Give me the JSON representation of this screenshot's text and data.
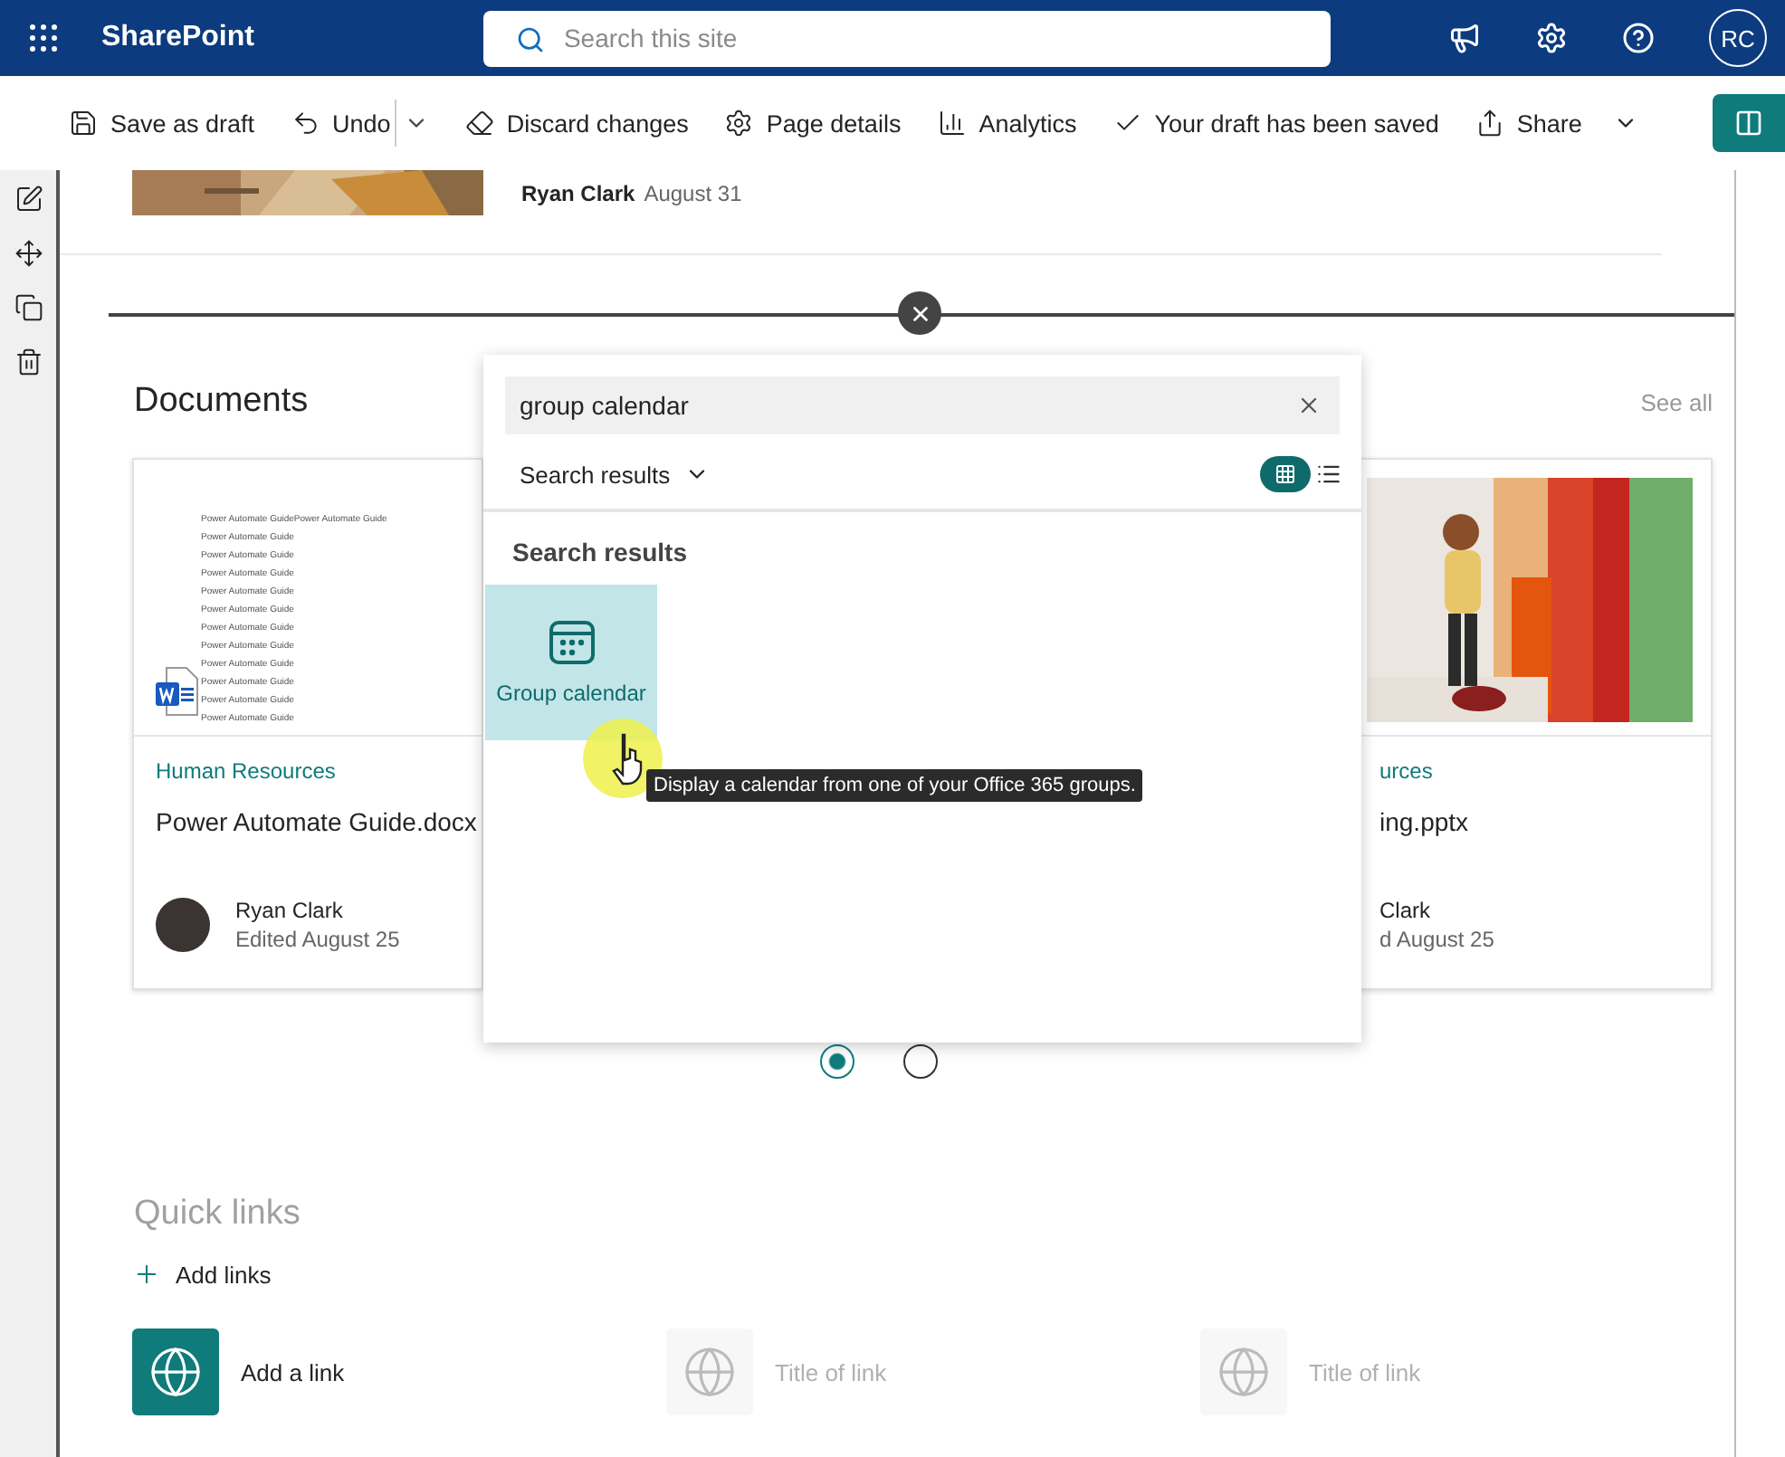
{
  "top_bar": {
    "app_name": "SharePoint",
    "search": {
      "placeholder": "Search this site"
    },
    "avatar": "RC"
  },
  "toolbar": {
    "items": [
      {
        "kind": "save",
        "label": "Save as draft"
      },
      {
        "kind": "undo",
        "label": "Undo"
      },
      {
        "kind": "discard",
        "label": "Discard changes"
      },
      {
        "kind": "details",
        "label": "Page details"
      },
      {
        "kind": "analytics",
        "label": "Analytics"
      },
      {
        "kind": "saved",
        "label": "Your draft has been saved"
      },
      {
        "kind": "share",
        "label": "Share"
      }
    ]
  },
  "news_item": {
    "author": "Ryan Clark",
    "date": "August 31"
  },
  "documents": {
    "title": "Documents",
    "see_all": "See all",
    "cards": [
      {
        "kind": "doc",
        "site": "Human Resources",
        "name": "Power Automate Guide.docx",
        "author": "Ryan Clark",
        "edited": "Edited August 25",
        "preview_lines": [
          "Power Automate GuidePower Automate Guide",
          "Power Automate Guide",
          "Power Automate Guide",
          "Power Automate Guide",
          "Power Automate Guide",
          "Power Automate Guide",
          "Power Automate Guide",
          "Power Automate Guide",
          "Power Automate Guide",
          "Power Automate Guide",
          "Power Automate Guide",
          "Power Automate Guide"
        ]
      },
      {
        "kind": "picture",
        "site": "urces",
        "name": "ing.pptx",
        "author": "Clark",
        "edited": "d August 25"
      }
    ],
    "pager": [
      {
        "selected": true
      },
      {
        "selected": false
      }
    ]
  },
  "toolbox": {
    "search_value": "group calendar",
    "filter": "Search results",
    "views": [
      {
        "kind": "grid",
        "selected": true
      },
      {
        "kind": "list",
        "selected": false
      }
    ],
    "heading": "Search results",
    "results": [
      {
        "label": "Group calendar",
        "selected": true
      }
    ],
    "tooltip": "Display a calendar from one of your Office 365 groups."
  },
  "quick_links": {
    "title": "Quick links",
    "add": "Add links",
    "links": [
      {
        "kind": "active",
        "label": "Add a link"
      },
      {
        "kind": "placeholder",
        "label": "Title of link"
      },
      {
        "kind": "placeholder",
        "label": "Title of link"
      }
    ]
  }
}
